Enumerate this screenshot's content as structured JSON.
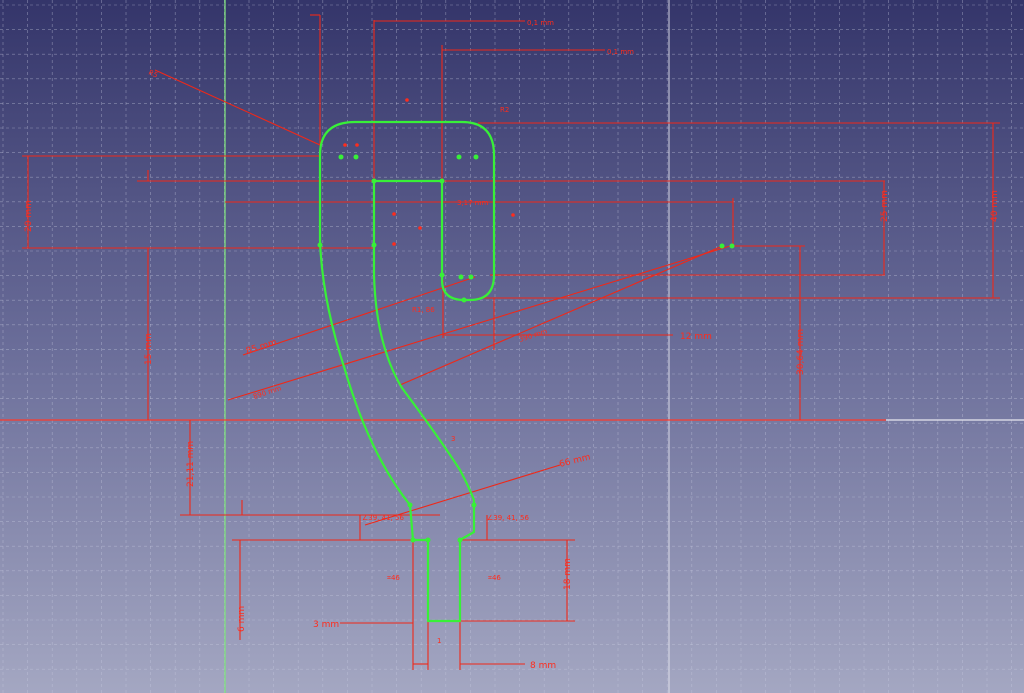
{
  "dimensions": {
    "top_1": "0,1 mm",
    "top_2": "0,1 mm",
    "diag_topleft": "R5",
    "left_20": "20 mm",
    "middle_dist": "3,17 mm",
    "right_25": "25 mm",
    "right_40": "40 mm",
    "left_15": "15 mm",
    "radius_85": "85 mm",
    "radius_890": "890 mm",
    "radius_390": "390 mm",
    "h_12": "12 mm",
    "v_3064": "30,64 mm",
    "v_2111": "21,11 mm",
    "radius_66": "66 mm",
    "angle_left": "∠39, 41, 56",
    "angle_right": "∠39, 41, 56",
    "v_18": "18 mm",
    "v_6": "6 mm",
    "h_3": "3 mm",
    "h_8": "8 mm",
    "sym_46_left": "⌗46",
    "sym_46_right": "⌗46",
    "small_r": "R1, 86",
    "label_3": "3",
    "label_1": "1",
    "label_r": "R2"
  }
}
